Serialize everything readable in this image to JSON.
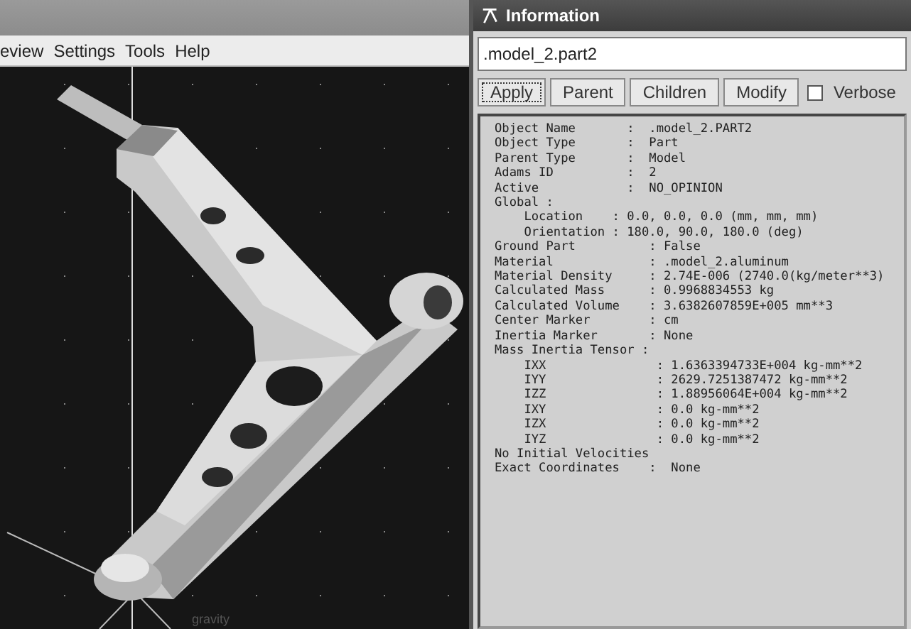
{
  "main_window": {
    "menu": [
      {
        "label": "eview"
      },
      {
        "label": "Settings"
      },
      {
        "label": "Tools"
      },
      {
        "label": "Help"
      }
    ],
    "viewport": {
      "labels": [
        {
          "text": "gravity"
        }
      ]
    }
  },
  "info_window": {
    "title": "Information",
    "object_field": {
      "value": ".model_2.part2"
    },
    "buttons": [
      {
        "label": "Apply",
        "focused": true
      },
      {
        "label": "Parent",
        "focused": false
      },
      {
        "label": "Children",
        "focused": false
      },
      {
        "label": "Modify",
        "focused": false
      }
    ],
    "verbose": {
      "label": "Verbose",
      "checked": false
    },
    "lines": [
      "Object Name       :  .model_2.PART2",
      "Object Type       :  Part",
      "Parent Type       :  Model",
      "Adams ID          :  2",
      "Active            :  NO_OPINION",
      "Global :",
      "    Location    : 0.0, 0.0, 0.0 (mm, mm, mm)",
      "    Orientation : 180.0, 90.0, 180.0 (deg)",
      "Ground Part          : False",
      "Material             : .model_2.aluminum",
      "Material Density     : 2.74E-006 (2740.0(kg/meter**3)",
      "Calculated Mass      : 0.9968834553 kg",
      "Calculated Volume    : 3.6382607859E+005 mm**3",
      "Center Marker        : cm",
      "Inertia Marker       : None",
      "Mass Inertia Tensor :",
      "    IXX               : 1.6363394733E+004 kg-mm**2",
      "    IYY               : 2629.7251387472 kg-mm**2",
      "    IZZ               : 1.88956064E+004 kg-mm**2",
      "    IXY               : 0.0 kg-mm**2",
      "    IZX               : 0.0 kg-mm**2",
      "    IYZ               : 0.0 kg-mm**2",
      "No Initial Velocities",
      "Exact Coordinates    :  None"
    ]
  }
}
